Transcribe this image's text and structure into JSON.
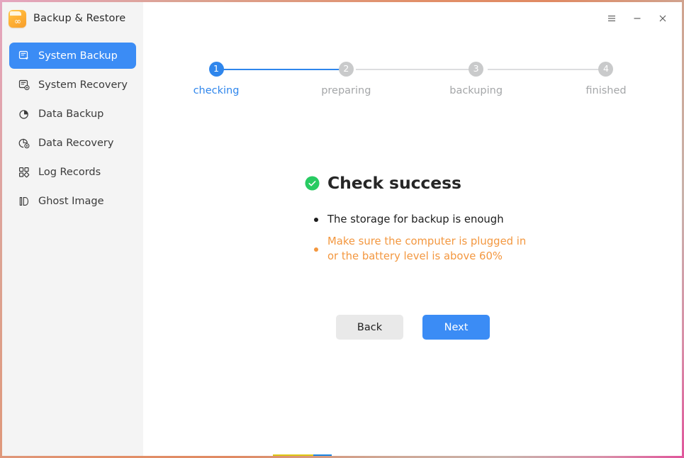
{
  "window": {
    "app_title": "Backup & Restore",
    "app_icon": "backup-restore-app-icon",
    "controls": [
      {
        "name": "menu-button",
        "icon": "hamburger-menu-icon",
        "label": "☰"
      },
      {
        "name": "minimize-button",
        "icon": "minimize-icon",
        "label": "─"
      },
      {
        "name": "close-button",
        "icon": "close-icon",
        "label": "✕"
      }
    ],
    "border_gradient_colors": [
      "#e4a5c0",
      "#e18f68",
      "#c9b2ab",
      "#e0559b"
    ]
  },
  "sidebar": {
    "background": "#f4f4f4",
    "active_color": "#3b8cf5",
    "items": [
      {
        "label": "System Backup",
        "icon": "system-backup-icon",
        "active": true
      },
      {
        "label": "System Recovery",
        "icon": "system-recovery-icon",
        "active": false
      },
      {
        "label": "Data Backup",
        "icon": "data-backup-pie-icon",
        "active": false
      },
      {
        "label": "Data Recovery",
        "icon": "data-recovery-icon",
        "active": false
      },
      {
        "label": "Log Records",
        "icon": "log-records-icon",
        "active": false
      },
      {
        "label": "Ghost Image",
        "icon": "ghost-image-icon",
        "active": false
      }
    ]
  },
  "stepper": {
    "current_step": 1,
    "total_steps": 4,
    "active_color": "#2f86ec",
    "inactive_color": "#c9cacb",
    "steps": [
      {
        "number": "1",
        "label": "checking",
        "state": "active"
      },
      {
        "number": "2",
        "label": "preparing",
        "state": "pending"
      },
      {
        "number": "3",
        "label": "backuping",
        "state": "pending"
      },
      {
        "number": "4",
        "label": "finished",
        "state": "pending"
      }
    ]
  },
  "result": {
    "status_icon": "success-check-circle-icon",
    "status_color": "#28cb62",
    "title": "Check success",
    "items": [
      {
        "text": "The storage for backup is enough",
        "severity": "ok",
        "color": "#1d1d1d"
      },
      {
        "text": "Make sure the computer is plugged in or the battery level is above 60%",
        "severity": "warning",
        "color": "#f3973f"
      }
    ]
  },
  "buttons": {
    "back_label": "Back",
    "next_label": "Next",
    "primary_color": "#3b8cf5",
    "secondary_color": "#e9e9e9"
  },
  "bottom_indicator": {
    "segments": [
      {
        "name": "yellow-segment",
        "color": "#ddc712"
      },
      {
        "name": "blue-segment",
        "color": "#1a84e0"
      }
    ]
  }
}
